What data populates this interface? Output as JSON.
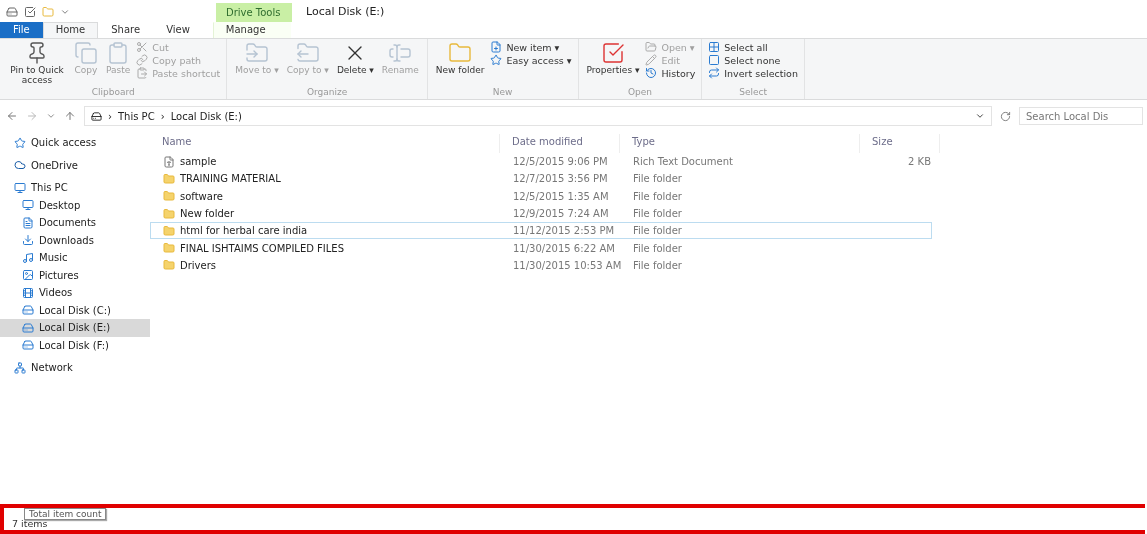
{
  "title_bar": {
    "context_tab": "Drive Tools",
    "title": "Local Disk (E:)"
  },
  "tabs": [
    {
      "label": "File",
      "kind": "file",
      "selected": false
    },
    {
      "label": "Home",
      "kind": "normal",
      "selected": true
    },
    {
      "label": "Share",
      "kind": "normal",
      "selected": false
    },
    {
      "label": "View",
      "kind": "normal",
      "selected": false
    },
    {
      "label": "Manage",
      "kind": "context",
      "selected": false
    }
  ],
  "ribbon": {
    "groups": [
      {
        "label": "Clipboard",
        "large": [
          {
            "label": "Pin to Quick access",
            "disabled": false
          },
          {
            "label": "Copy",
            "disabled": true
          },
          {
            "label": "Paste",
            "disabled": true
          }
        ],
        "small": [
          {
            "label": "Cut",
            "disabled": true
          },
          {
            "label": "Copy path",
            "disabled": true
          },
          {
            "label": "Paste shortcut",
            "disabled": true
          }
        ]
      },
      {
        "label": "Organize",
        "large": [
          {
            "label": "Move to ▾",
            "disabled": true
          },
          {
            "label": "Copy to ▾",
            "disabled": true
          },
          {
            "label": "Delete ▾",
            "disabled": false
          },
          {
            "label": "Rename",
            "disabled": true
          }
        ]
      },
      {
        "label": "New",
        "large": [
          {
            "label": "New folder",
            "disabled": false
          }
        ],
        "small": [
          {
            "label": "New item ▾",
            "disabled": false
          },
          {
            "label": "Easy access ▾",
            "disabled": false
          }
        ]
      },
      {
        "label": "Open",
        "large": [
          {
            "label": "Properties ▾",
            "disabled": false
          }
        ],
        "small": [
          {
            "label": "Open ▾",
            "disabled": true
          },
          {
            "label": "Edit",
            "disabled": true
          },
          {
            "label": "History",
            "disabled": false
          }
        ]
      },
      {
        "label": "Select",
        "small": [
          {
            "label": "Select all",
            "disabled": false
          },
          {
            "label": "Select none",
            "disabled": false
          },
          {
            "label": "Invert selection",
            "disabled": false
          }
        ]
      }
    ]
  },
  "address": {
    "separator": "›",
    "path": [
      "This PC",
      "Local Disk (E:)"
    ],
    "search": {
      "placeholder": "Search Local Dis"
    }
  },
  "sidebar": {
    "items": [
      {
        "label": "Quick access",
        "selected": false
      },
      {
        "label": "OneDrive",
        "selected": false
      },
      {
        "label": "This PC",
        "selected": false,
        "children": [
          {
            "label": "Desktop",
            "selected": false
          },
          {
            "label": "Documents",
            "selected": false
          },
          {
            "label": "Downloads",
            "selected": false
          },
          {
            "label": "Music",
            "selected": false
          },
          {
            "label": "Pictures",
            "selected": false
          },
          {
            "label": "Videos",
            "selected": false
          },
          {
            "label": "Local Disk (C:)",
            "selected": false
          },
          {
            "label": "Local Disk (E:)",
            "selected": true
          },
          {
            "label": "Local Disk (F:)",
            "selected": false
          }
        ]
      },
      {
        "label": "Network",
        "selected": false
      }
    ]
  },
  "table": {
    "columns": [
      "Name",
      "Date modified",
      "Type",
      "Size"
    ],
    "rows": [
      {
        "kind": "file",
        "name": "sample",
        "date": "12/5/2015 9:06 PM",
        "type": "Rich Text Document",
        "size": "2 KB",
        "focused": false
      },
      {
        "kind": "folder",
        "name": "TRAINING MATERIAL",
        "date": "12/7/2015 3:56 PM",
        "type": "File folder",
        "focused": false
      },
      {
        "kind": "folder",
        "name": "software",
        "date": "12/5/2015 1:35 AM",
        "type": "File folder",
        "focused": false
      },
      {
        "kind": "folder",
        "name": "New folder",
        "date": "12/9/2015 7:24 AM",
        "type": "File folder",
        "focused": false
      },
      {
        "kind": "folder",
        "name": "html for herbal care india",
        "date": "11/12/2015 2:53 PM",
        "type": "File folder",
        "focused": true
      },
      {
        "kind": "folder",
        "name": "FINAL ISHTAIMS COMPILED FILES",
        "date": "11/30/2015 6:22 AM",
        "type": "File folder",
        "focused": false
      },
      {
        "kind": "folder",
        "name": "Drivers",
        "date": "11/30/2015 10:53 AM",
        "type": "File folder",
        "focused": false
      }
    ]
  },
  "status_bar": {
    "text": "7 items",
    "tooltip": "Total item count",
    "highlighted": true
  }
}
